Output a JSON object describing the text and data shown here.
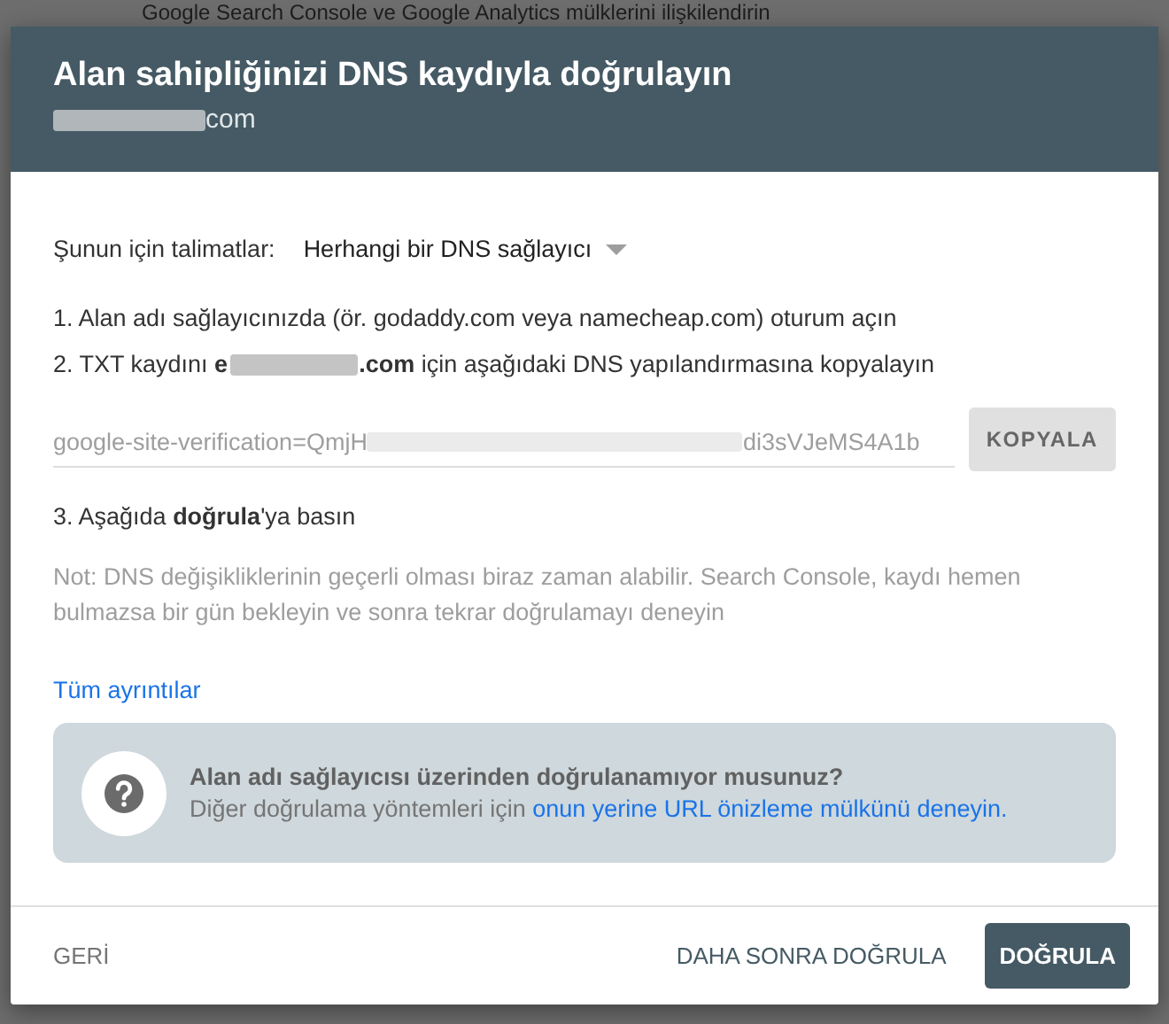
{
  "background": {
    "heading": "Google Search Console ve Google Analytics mülklerini ilişkilendirin"
  },
  "dialog": {
    "title": "Alan sahipliğinizi DNS kaydıyla doğrulayın",
    "subtitle": {
      "visible_end": "com"
    },
    "instructions_for": {
      "label": "Şunun için talimatlar:",
      "value": "Herhangi bir DNS sağlayıcı"
    },
    "steps": [
      {
        "kind": "plain",
        "text": "1. Alan adı sağlayıcınızda (ör. godaddy.com veya namecheap.com) oturum açın"
      },
      {
        "kind": "redacted",
        "before": "2. TXT kaydını **e**",
        "after": "**.com** için aşağıdaki DNS yapılandırmasına kopyalayın"
      }
    ],
    "record": {
      "start": "google-site-verification=QmjH",
      "end": "di3sVJeMS4A1b",
      "copy_button": "KOPYALA"
    },
    "step_3": "3. Aşağıda **doğrula**'ya basın",
    "note": "Not: DNS değişikliklerinin geçerli olması biraz zaman alabilir. Search Console, kaydı hemen bulmazsa bir gün bekleyin ve sonra tekrar doğrulamayı deneyin",
    "details_link": "Tüm ayrıntılar",
    "help_box": {
      "title": "Alan adı sağlayıcısı üzerinden doğrulanamıyor musunuz?",
      "text": "Diğer doğrulama yöntemleri için",
      "link": "onun yerine URL önizleme mülkünü deneyin."
    },
    "footer": {
      "back": "GERİ",
      "later": "DAHA SONRA DOĞRULA",
      "verify": "DOĞRULA"
    }
  }
}
